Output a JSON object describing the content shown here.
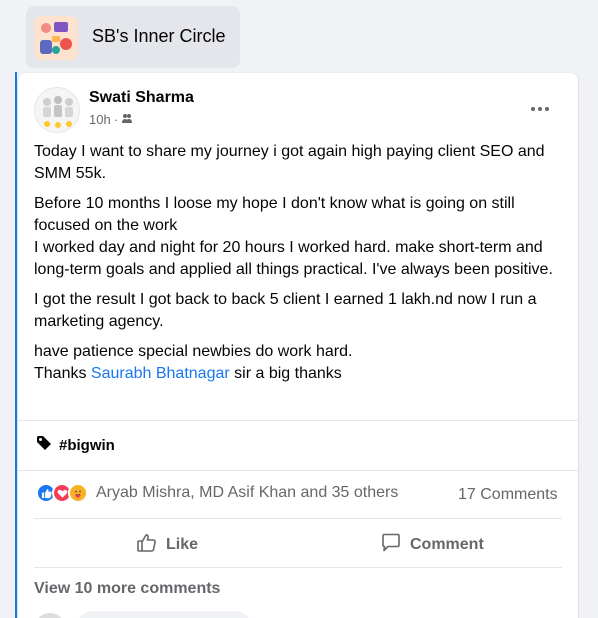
{
  "group": {
    "name": "SB's Inner Circle",
    "icon": "group-illustration-icon"
  },
  "post": {
    "author": "Swati Sharma",
    "time": "10h",
    "audience_icon": "group-audience-icon",
    "paragraphs": {
      "p1": "Today I want to share my journey i got again high paying client SEO and SMM 55k.",
      "p2a": "Before  10 months I loose my hope I don't know what is going on still focused on the work",
      "p2b": "I worked day and night for 20 hours I worked hard. make short-term and long-term goals and applied all things practical. I've always been positive.",
      "p3": "I got the result I got back to back 5 client I earned 1 lakh.nd now I run a marketing agency.",
      "p4a": "have patience special newbies do work hard.",
      "p4b_prefix": "Thanks ",
      "p4b_mention": "Saurabh Bhatnagar",
      "p4b_suffix": " sir a big thanks"
    },
    "tag": "#bigwin",
    "reactions": {
      "types": [
        "like",
        "love",
        "care"
      ],
      "names": "Aryab Mishra, MD Asif Khan and 35 others"
    },
    "comments_count": "17 Comments",
    "actions": {
      "like": "Like",
      "comment": "Comment"
    },
    "view_more_comments": "View 10 more comments"
  },
  "colors": {
    "accent": "#1877f2",
    "secondary_text": "#65676b",
    "love": "#f33e58",
    "care": "#f7b125"
  }
}
